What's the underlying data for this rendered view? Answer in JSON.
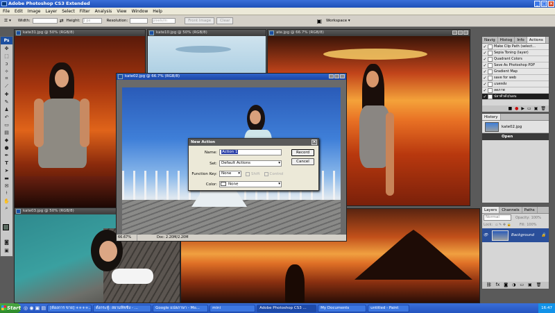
{
  "app": {
    "title": "Adobe Photoshop CS3 Extended"
  },
  "menu": [
    "File",
    "Edit",
    "Image",
    "Layer",
    "Select",
    "Filter",
    "Analysis",
    "View",
    "Window",
    "Help"
  ],
  "options": {
    "width_label": "Width:",
    "height_label": "Height:",
    "height_unit": "1 px",
    "resolution_label": "Resolution:",
    "resolution_unit": "pixels/in",
    "front_image": "Front Image",
    "clear": "Clear",
    "workspace": "Workspace ▾"
  },
  "toolbox": {
    "logo": "Ps"
  },
  "documents": {
    "kate31": "kate31.jpg @ 50% (RGB/8)",
    "kate10": "kate10.jpg @ 50% (RGB/8)",
    "kate_right": "ate.jpg @ 66.7% (RGB/8)",
    "kate02": "kate02.jpg @ 66.7% (RGB/8)",
    "kate03": "kate03.jpg @ 50% (RGB/8)",
    "kate02_zoom": "66.67%",
    "kate02_doc": "Doc: 2.20M/2.20M"
  },
  "actions_panel": {
    "tabs": [
      "Navig",
      "Histog",
      "Info",
      "Actions"
    ],
    "items": [
      "Make Clip Path (select...",
      "Sepia Toning (layer)",
      "Quadrant Colors",
      "Save As Photoshop PDF",
      "Gradient Map",
      "save for web",
      "แบตหลัง",
      "ลดภาพ",
      "ปลาตัวดัง/นอน"
    ]
  },
  "history_panel": {
    "title": "History",
    "snapshot": "kate02.jpg",
    "state": "Open"
  },
  "layers_panel": {
    "tabs": [
      "Layers",
      "Channels",
      "Paths"
    ],
    "blend_mode": "Normal",
    "opacity_label": "Opacity:",
    "opacity": "100%",
    "lock_label": "Lock:",
    "fill_label": "Fill:",
    "fill": "100%",
    "layer_name": "Background"
  },
  "dialog": {
    "title": "New Action",
    "name_label": "Name:",
    "name_value": "Action 1",
    "set_label": "Set:",
    "set_value": "Default Actions",
    "fkey_label": "Function Key:",
    "fkey_value": "None",
    "shift_label": "Shift",
    "control_label": "Control",
    "color_label": "Color:",
    "color_value": "None",
    "record": "Record",
    "cancel": "Cancel"
  },
  "taskbar": {
    "start": "Start",
    "items": [
      "[ต้องการ ขาย] ++++...",
      "ตั้งกระทู้: สยามฟิชชิ่ง - ...",
      "Google แปลภาษา - Mo...",
      "mini",
      "Adobe Photoshop CS3 ...",
      "My Documents",
      "untitled - Paint"
    ],
    "clock": "16:47"
  }
}
